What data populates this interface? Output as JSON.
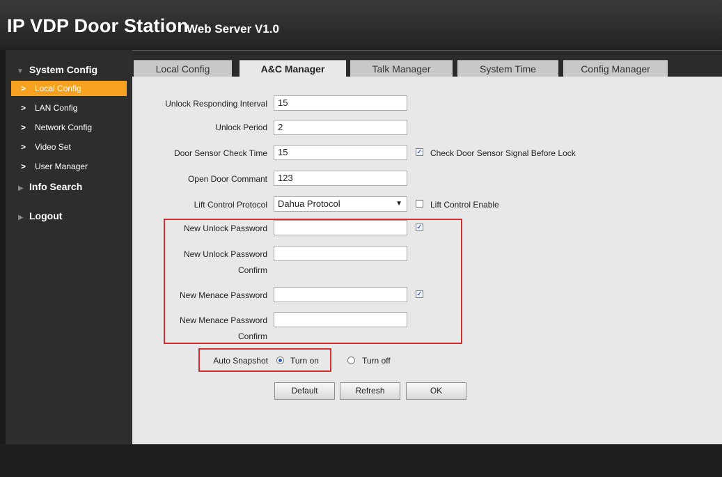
{
  "header": {
    "title": "IP VDP Door Station",
    "subtitle": "Web Server V1.0"
  },
  "sidebar": {
    "system_config": "System Config",
    "items": [
      {
        "label": "Local Config",
        "active": true
      },
      {
        "label": "LAN Config"
      },
      {
        "label": "Network Config"
      },
      {
        "label": "Video Set"
      },
      {
        "label": "User Manager"
      }
    ],
    "info_search": "Info Search",
    "logout": "Logout"
  },
  "tabs": [
    {
      "label": "Local Config"
    },
    {
      "label": "A&C Manager",
      "active": true
    },
    {
      "label": "Talk Manager"
    },
    {
      "label": "System Time"
    },
    {
      "label": "Config Manager"
    }
  ],
  "form": {
    "unlock_interval_label": "Unlock Responding Interval",
    "unlock_interval_value": "15",
    "unlock_period_label": "Unlock Period",
    "unlock_period_value": "2",
    "door_sensor_label": "Door Sensor Check Time",
    "door_sensor_value": "15",
    "door_sensor_check_label": "Check Door Sensor Signal Before Lock",
    "open_door_label": "Open Door Commant",
    "open_door_value": "123",
    "lift_label": "Lift Control Protocol",
    "lift_value": "Dahua Protocol",
    "lift_enable_label": "Lift Control Enable",
    "new_unlock_label": "New Unlock Password",
    "new_unlock_value": "",
    "new_unlock_confirm_line1": "New Unlock Password",
    "new_unlock_confirm_line2": "Confirm",
    "new_unlock_confirm_value": "",
    "new_menace_label": "New Menace Password",
    "new_menace_value": "",
    "new_menace_confirm_line1": "New Menace Password",
    "new_menace_confirm_line2": "Confirm",
    "new_menace_confirm_value": "",
    "auto_snapshot_label": "Auto Snapshot",
    "turn_on_label": "Turn on",
    "turn_off_label": "Turn off"
  },
  "buttons": {
    "default": "Default",
    "refresh": "Refresh",
    "ok": "OK"
  },
  "icons": {
    "checked": "checkbox-checked",
    "radio": "radio-selected",
    "chevron": "chevron-right-icon",
    "triangle": "triangle-icon",
    "dropdown": "dropdown-arrow-icon"
  },
  "colors": {
    "active_item": "#f6a11f",
    "highlight_box": "#d92d2d",
    "panel": "#e8e8e8"
  }
}
